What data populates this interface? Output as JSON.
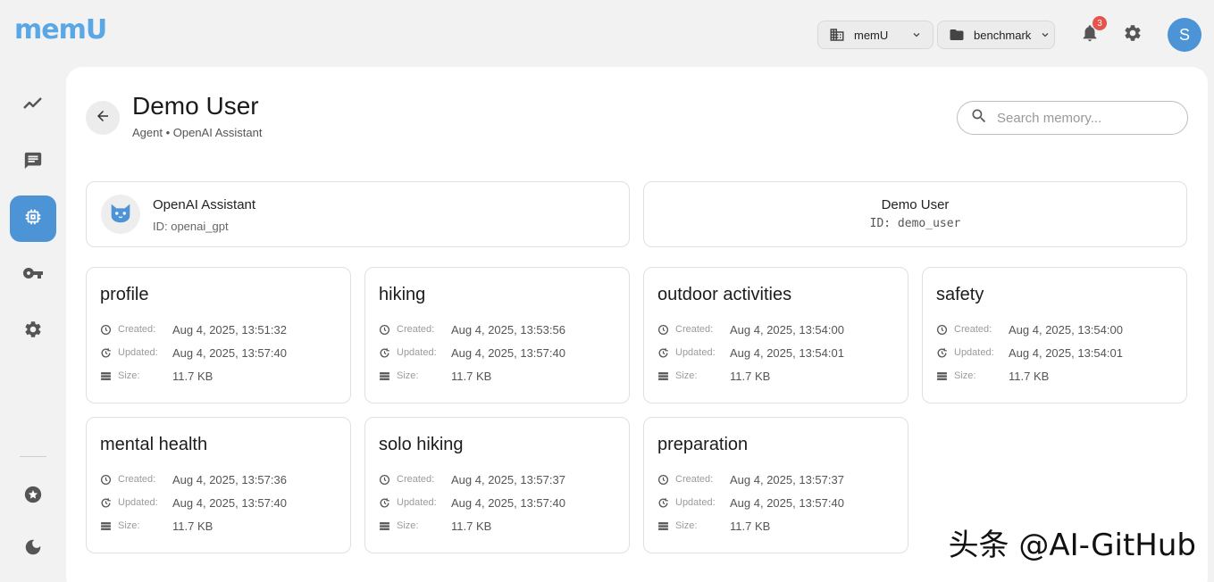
{
  "app": {
    "logo_text": "memU"
  },
  "topbar": {
    "org_selector": {
      "label": "memU"
    },
    "project_selector": {
      "label": "benchmark"
    },
    "notifications": {
      "count": "3"
    },
    "avatar": {
      "initial": "S"
    }
  },
  "sidebar": {
    "items": [
      {
        "name": "analytics",
        "icon": "trend-icon",
        "active": false
      },
      {
        "name": "chat",
        "icon": "chat-icon",
        "active": false
      },
      {
        "name": "memory",
        "icon": "chip-icon",
        "active": true
      },
      {
        "name": "api-keys",
        "icon": "key-icon",
        "active": false
      },
      {
        "name": "settings",
        "icon": "gear-icon",
        "active": false
      },
      {
        "name": "favorites",
        "icon": "star-icon",
        "active": false
      },
      {
        "name": "theme",
        "icon": "moon-icon",
        "active": false
      }
    ],
    "active_color": "#4c94d6"
  },
  "header": {
    "title": "Demo User",
    "subtitle": "Agent • OpenAI Assistant"
  },
  "search": {
    "placeholder": "Search memory..."
  },
  "agent_card": {
    "name": "OpenAI Assistant",
    "id": "ID: openai_gpt"
  },
  "user_card": {
    "name": "Demo User",
    "id": "ID: demo_user"
  },
  "labels": {
    "created": "Created:",
    "updated": "Updated:",
    "size": "Size:"
  },
  "memories": [
    {
      "title": "profile",
      "created": "Aug 4, 2025, 13:51:32",
      "updated": "Aug 4, 2025, 13:57:40",
      "size": "11.7 KB"
    },
    {
      "title": "hiking",
      "created": "Aug 4, 2025, 13:53:56",
      "updated": "Aug 4, 2025, 13:57:40",
      "size": "11.7 KB"
    },
    {
      "title": "outdoor activities",
      "created": "Aug 4, 2025, 13:54:00",
      "updated": "Aug 4, 2025, 13:54:01",
      "size": "11.7 KB"
    },
    {
      "title": "safety",
      "created": "Aug 4, 2025, 13:54:00",
      "updated": "Aug 4, 2025, 13:54:01",
      "size": "11.7 KB"
    },
    {
      "title": "mental health",
      "created": "Aug 4, 2025, 13:57:36",
      "updated": "Aug 4, 2025, 13:57:40",
      "size": "11.7 KB"
    },
    {
      "title": "solo hiking",
      "created": "Aug 4, 2025, 13:57:37",
      "updated": "Aug 4, 2025, 13:57:40",
      "size": "11.7 KB"
    },
    {
      "title": "preparation",
      "created": "Aug 4, 2025, 13:57:37",
      "updated": "Aug 4, 2025, 13:57:40",
      "size": "11.7 KB"
    }
  ],
  "watermark": "头条 @AI-GitHub"
}
